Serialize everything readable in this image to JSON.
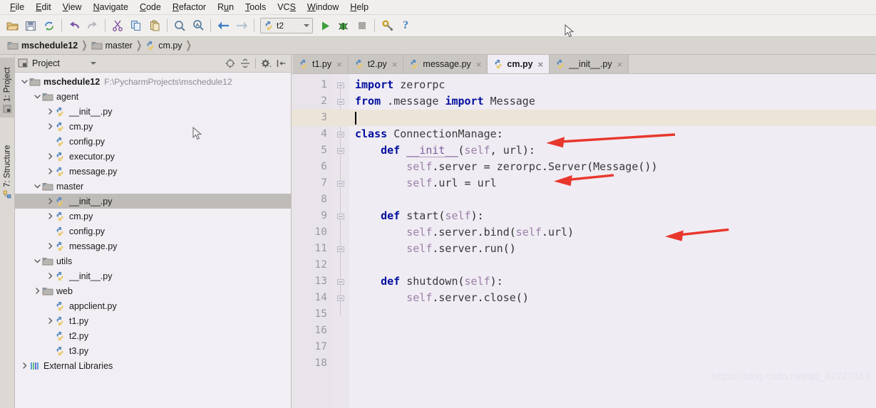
{
  "menubar": {
    "items": [
      {
        "label": "File",
        "mnemonic": "F"
      },
      {
        "label": "Edit",
        "mnemonic": "E"
      },
      {
        "label": "View",
        "mnemonic": "V"
      },
      {
        "label": "Navigate",
        "mnemonic": "N"
      },
      {
        "label": "Code",
        "mnemonic": "C"
      },
      {
        "label": "Refactor",
        "mnemonic": "R"
      },
      {
        "label": "Run",
        "mnemonic": "u"
      },
      {
        "label": "Tools",
        "mnemonic": "T"
      },
      {
        "label": "VCS",
        "mnemonic": "S"
      },
      {
        "label": "Window",
        "mnemonic": "W"
      },
      {
        "label": "Help",
        "mnemonic": "H"
      }
    ]
  },
  "toolbar": {
    "buttons": [
      {
        "name": "open-folder-icon",
        "title": "Open"
      },
      {
        "name": "save-all-icon",
        "title": "Save All"
      },
      {
        "name": "sync-icon",
        "title": "Synchronize"
      },
      {
        "name": "undo-icon",
        "title": "Undo"
      },
      {
        "name": "redo-icon",
        "title": "Redo"
      },
      {
        "name": "cut-icon",
        "title": "Cut"
      },
      {
        "name": "copy-icon",
        "title": "Copy"
      },
      {
        "name": "paste-icon",
        "title": "Paste"
      },
      {
        "name": "find-icon",
        "title": "Find"
      },
      {
        "name": "find-replace-icon",
        "title": "Replace"
      },
      {
        "name": "back-icon",
        "title": "Back"
      },
      {
        "name": "forward-icon",
        "title": "Forward"
      }
    ],
    "run_config": {
      "label": "t2"
    },
    "run_button": "run-icon",
    "debug_button": "debug-icon",
    "stop_button": "stop-icon",
    "settings_button": "settings-icon",
    "help_button": "help-icon"
  },
  "breadcrumb": {
    "items": [
      {
        "label": "mschedule12",
        "icon": "folder-icon",
        "bold": true
      },
      {
        "label": "master",
        "icon": "folder-icon",
        "bold": false
      },
      {
        "label": "cm.py",
        "icon": "python-file-icon",
        "bold": false
      }
    ]
  },
  "left_strip": {
    "tabs": [
      {
        "label": "1: Project",
        "icon": "project-icon",
        "active": true
      },
      {
        "label": "7: Structure",
        "icon": "structure-icon",
        "active": false
      }
    ]
  },
  "project_panel": {
    "title": "Project",
    "tools": [
      {
        "name": "collapse-target-icon"
      },
      {
        "name": "collapse-all-icon"
      },
      {
        "name": "settings-gear-icon"
      },
      {
        "name": "hide-panel-icon"
      }
    ],
    "tree": [
      {
        "label": "mschedule12",
        "path": "F:\\PycharmProjects\\mschedule12",
        "icon": "folder-icon",
        "indent": 0,
        "arrow": "down",
        "bold": true,
        "selected": false
      },
      {
        "label": "agent",
        "icon": "folder-icon",
        "indent": 1,
        "arrow": "down",
        "bold": false,
        "selected": false
      },
      {
        "label": "__init__.py",
        "icon": "python-file-icon",
        "indent": 2,
        "arrow": "right",
        "bold": false,
        "selected": false
      },
      {
        "label": "cm.py",
        "icon": "python-file-icon",
        "indent": 2,
        "arrow": "right",
        "bold": false,
        "selected": false
      },
      {
        "label": "config.py",
        "icon": "python-file-icon",
        "indent": 2,
        "arrow": "none",
        "bold": false,
        "selected": false
      },
      {
        "label": "executor.py",
        "icon": "python-file-icon",
        "indent": 2,
        "arrow": "right",
        "bold": false,
        "selected": false
      },
      {
        "label": "message.py",
        "icon": "python-file-icon",
        "indent": 2,
        "arrow": "right",
        "bold": false,
        "selected": false
      },
      {
        "label": "master",
        "icon": "folder-icon",
        "indent": 1,
        "arrow": "down",
        "bold": false,
        "selected": false
      },
      {
        "label": "__init__.py",
        "icon": "python-file-icon",
        "indent": 2,
        "arrow": "right",
        "bold": false,
        "selected": true
      },
      {
        "label": "cm.py",
        "icon": "python-file-icon",
        "indent": 2,
        "arrow": "right",
        "bold": false,
        "selected": false
      },
      {
        "label": "config.py",
        "icon": "python-file-icon",
        "indent": 2,
        "arrow": "none",
        "bold": false,
        "selected": false
      },
      {
        "label": "message.py",
        "icon": "python-file-icon",
        "indent": 2,
        "arrow": "right",
        "bold": false,
        "selected": false
      },
      {
        "label": "utils",
        "icon": "folder-icon",
        "indent": 1,
        "arrow": "down",
        "bold": false,
        "selected": false
      },
      {
        "label": "__init__.py",
        "icon": "python-file-icon",
        "indent": 2,
        "arrow": "right",
        "bold": false,
        "selected": false
      },
      {
        "label": "web",
        "icon": "folder-icon",
        "indent": 1,
        "arrow": "right",
        "bold": false,
        "selected": false
      },
      {
        "label": "appclient.py",
        "icon": "python-file-icon",
        "indent": 2,
        "arrow": "none",
        "bold": false,
        "selected": false
      },
      {
        "label": "t1.py",
        "icon": "python-file-icon",
        "indent": 2,
        "arrow": "right",
        "bold": false,
        "selected": false
      },
      {
        "label": "t2.py",
        "icon": "python-file-icon",
        "indent": 2,
        "arrow": "none",
        "bold": false,
        "selected": false
      },
      {
        "label": "t3.py",
        "icon": "python-file-icon",
        "indent": 2,
        "arrow": "none",
        "bold": false,
        "selected": false
      },
      {
        "label": "External Libraries",
        "icon": "libraries-icon",
        "indent": 0,
        "arrow": "right",
        "bold": false,
        "selected": false
      }
    ]
  },
  "editor": {
    "tabs": [
      {
        "label": "t1.py",
        "icon": "python-file-icon",
        "active": false
      },
      {
        "label": "t2.py",
        "icon": "python-file-icon",
        "active": false
      },
      {
        "label": "message.py",
        "icon": "python-file-icon",
        "active": false
      },
      {
        "label": "cm.py",
        "icon": "python-file-icon",
        "active": true
      },
      {
        "label": "__init__.py",
        "icon": "python-file-icon",
        "active": false
      }
    ],
    "close_glyph": "×",
    "current_line": 3,
    "total_lines": 18,
    "line_numbers": [
      "1",
      "2",
      "3",
      "4",
      "5",
      "6",
      "7",
      "8",
      "9",
      "10",
      "11",
      "12",
      "13",
      "14",
      "15",
      "16",
      "17",
      "18"
    ],
    "code_lines": [
      "import zerorpc",
      "from .message import Message",
      "",
      "class ConnectionManage:",
      "    def __init__(self, url):",
      "        self.server = zerorpc.Server(Message())",
      "        self.url = url",
      "",
      "    def start(self):",
      "        self.server.bind(self.url)",
      "        self.server.run()",
      "",
      "    def shutdown(self):",
      "        self.server.close()",
      "",
      "",
      "",
      ""
    ]
  },
  "annotations": {
    "arrows": [
      {
        "name": "arrow-init-signature",
        "target_line": 5
      },
      {
        "name": "arrow-self-url",
        "target_line": 7
      },
      {
        "name": "arrow-server-bind",
        "target_line": 10
      }
    ],
    "color": "#e8372c"
  },
  "watermark": {
    "text": "https://blog.csdn.net/qq_42227818"
  },
  "colors": {
    "editor_bg": "#f0ecf3",
    "gutter_bg": "#e8e4ea",
    "current_line": "#ece4d7",
    "keyword": "#000f9e",
    "self_param": "#9a7fa8",
    "selection": "#bfbbb7",
    "chrome": "#f1efed",
    "breadcrumb_bg": "#d8d4d0",
    "arrow_red": "#e8372c"
  }
}
